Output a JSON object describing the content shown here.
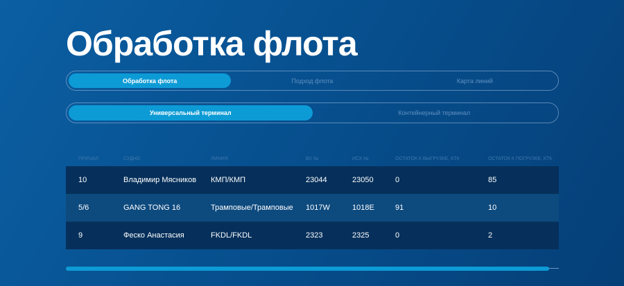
{
  "title": "Обработка флота",
  "tabs": [
    {
      "label": "Обработка флота",
      "active": true
    },
    {
      "label": "Подход флота",
      "active": false
    },
    {
      "label": "Карта линий",
      "active": false
    }
  ],
  "terminals": [
    {
      "label": "Универсальный терминал",
      "active": true
    },
    {
      "label": "Контейнерный терминал",
      "active": false
    }
  ],
  "table": {
    "headers": [
      "ПРИЧАЛ",
      "СУДНО",
      "ЛИНИЯ",
      "ВХ №",
      "ИСХ №",
      "ОСТАТОК К ВЫГРУЗКЕ, КТК",
      "ОСТАТОК К ПОГРУЗКЕ, КТК"
    ],
    "rows": [
      [
        "10",
        "Владимир Мясников",
        "КМП/КМП",
        "23044",
        "23050",
        "0",
        "85"
      ],
      [
        "5/6",
        "GANG TONG 16",
        "Трамповые/Трамповые",
        "1017W",
        "1018E",
        "91",
        "10"
      ],
      [
        "9",
        "Феско Анастасия",
        "FKDL/FKDL",
        "2323",
        "2325",
        "0",
        "2"
      ]
    ]
  },
  "scroll_fraction": 0.98
}
